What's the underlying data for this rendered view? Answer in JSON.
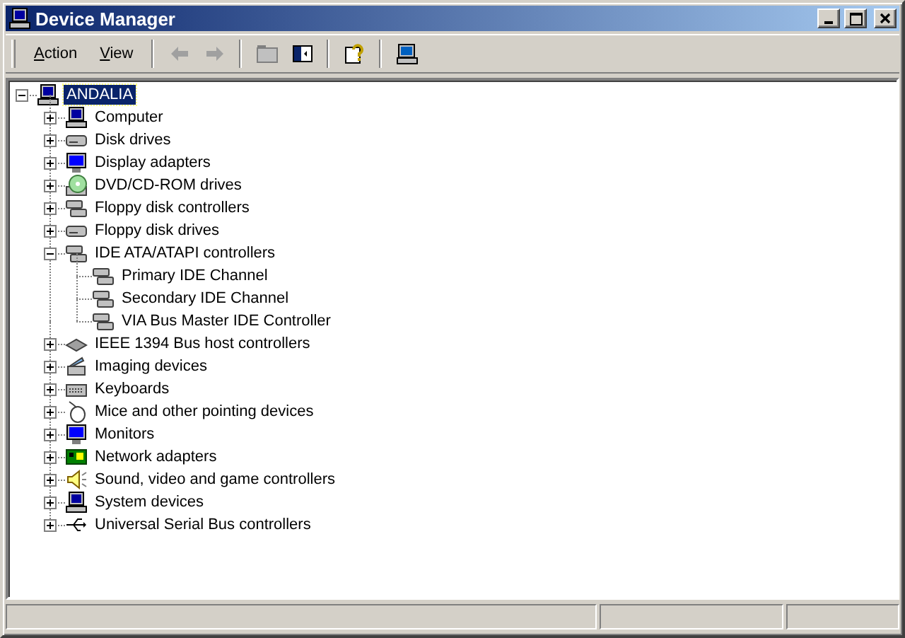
{
  "window": {
    "title": "Device Manager"
  },
  "menus": [
    {
      "label": "Action"
    },
    {
      "label": "View"
    }
  ],
  "toolbar": [
    {
      "kind": "back",
      "disabled": true
    },
    {
      "kind": "forward",
      "disabled": true
    },
    {
      "kind": "sep"
    },
    {
      "kind": "up",
      "disabled": true
    },
    {
      "kind": "tree",
      "disabled": false
    },
    {
      "kind": "sep"
    },
    {
      "kind": "help",
      "disabled": false
    },
    {
      "kind": "sep"
    },
    {
      "kind": "scan",
      "disabled": false
    }
  ],
  "tree": [
    {
      "label": "ANDALIA",
      "kind": "computer",
      "selected": true,
      "expanded": true,
      "children": [
        {
          "label": "Computer",
          "kind": "pc",
          "selected": false,
          "expanded": false
        },
        {
          "label": "Disk drives",
          "kind": "disk",
          "selected": false,
          "expanded": false
        },
        {
          "label": "Display adapters",
          "kind": "monitor",
          "selected": false,
          "expanded": false
        },
        {
          "label": "DVD/CD-ROM drives",
          "kind": "cdrom",
          "selected": false,
          "expanded": false
        },
        {
          "label": "Floppy disk controllers",
          "kind": "controller",
          "selected": false,
          "expanded": false
        },
        {
          "label": "Floppy disk drives",
          "kind": "disk",
          "selected": false,
          "expanded": false
        },
        {
          "label": "IDE ATA/ATAPI controllers",
          "kind": "controller",
          "selected": false,
          "expanded": true,
          "children": [
            {
              "label": "Primary IDE Channel",
              "kind": "controller",
              "selected": false
            },
            {
              "label": "Secondary IDE Channel",
              "kind": "controller",
              "selected": false
            },
            {
              "label": "VIA Bus Master IDE Controller",
              "kind": "controller",
              "selected": false
            }
          ]
        },
        {
          "label": "IEEE 1394 Bus host controllers",
          "kind": "chip",
          "selected": false,
          "expanded": false
        },
        {
          "label": "Imaging devices",
          "kind": "camera",
          "selected": false,
          "expanded": false
        },
        {
          "label": "Keyboards",
          "kind": "keyboard",
          "selected": false,
          "expanded": false
        },
        {
          "label": "Mice and other pointing devices",
          "kind": "mouse",
          "selected": false,
          "expanded": false
        },
        {
          "label": "Monitors",
          "kind": "monitor",
          "selected": false,
          "expanded": false
        },
        {
          "label": "Network adapters",
          "kind": "network",
          "selected": false,
          "expanded": false
        },
        {
          "label": "Sound, video and game controllers",
          "kind": "speaker",
          "selected": false,
          "expanded": false
        },
        {
          "label": "System devices",
          "kind": "pc",
          "selected": false,
          "expanded": false
        },
        {
          "label": "Universal Serial Bus controllers",
          "kind": "usb",
          "selected": false,
          "expanded": false
        }
      ]
    }
  ]
}
